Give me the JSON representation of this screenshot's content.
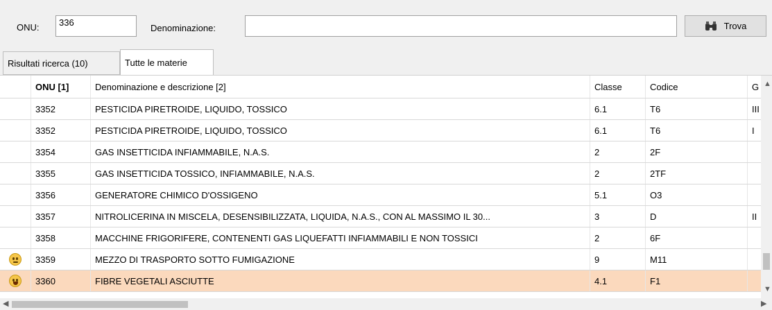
{
  "search": {
    "onu_label": "ONU:",
    "onu_value": "336",
    "denominazione_label": "Denominazione:",
    "denominazione_value": "",
    "trova_label": "Trova",
    "trova_icon": "binoculars-icon"
  },
  "tabs": [
    {
      "label": "Risultati ricerca (10)",
      "active": false
    },
    {
      "label": "Tutte le materie",
      "active": true
    }
  ],
  "table": {
    "headers": [
      "ONU [1]",
      "Denominazione e descrizione [2]",
      "Classe",
      "Codice",
      "G"
    ],
    "rows": [
      {
        "icon": "",
        "onu": "3352",
        "den": "PESTICIDA PIRETROIDE, LIQUIDO, TOSSICO",
        "classe": "6.1",
        "codice": "T6",
        "g": "III"
      },
      {
        "icon": "",
        "onu": "3352",
        "den": "PESTICIDA PIRETROIDE, LIQUIDO, TOSSICO",
        "classe": "6.1",
        "codice": "T6",
        "g": "I"
      },
      {
        "icon": "",
        "onu": "3354",
        "den": "GAS INSETTICIDA INFIAMMABILE, N.A.S.",
        "classe": "2",
        "codice": "2F",
        "g": ""
      },
      {
        "icon": "",
        "onu": "3355",
        "den": "GAS INSETTICIDA TOSSICO, INFIAMMABILE, N.A.S.",
        "classe": "2",
        "codice": "2TF",
        "g": ""
      },
      {
        "icon": "",
        "onu": "3356",
        "den": "GENERATORE CHIMICO D'OSSIGENO",
        "classe": "5.1",
        "codice": "O3",
        "g": ""
      },
      {
        "icon": "",
        "onu": "3357",
        "den": "NITROLICERINA IN MISCELA, DESENSIBILIZZATA, LIQUIDA, N.A.S., CON AL MASSIMO IL 30...",
        "classe": "3",
        "codice": "D",
        "g": "II"
      },
      {
        "icon": "",
        "onu": "3358",
        "den": "MACCHINE FRIGORIFERE, CONTENENTI GAS LIQUEFATTI INFIAMMABILI E NON TOSSICI",
        "classe": "2",
        "codice": "6F",
        "g": ""
      },
      {
        "icon": "neutral-face-icon",
        "onu": "3359",
        "den": "MEZZO DI TRASPORTO SOTTO FUMIGAZIONE",
        "classe": "9",
        "codice": "M11",
        "g": ""
      },
      {
        "icon": "grinning-face-icon",
        "onu": "3360",
        "den": "FIBRE VEGETALI ASCIUTTE",
        "classe": "4.1",
        "codice": "F1",
        "g": "",
        "selected": true
      }
    ]
  },
  "colors": {
    "selected_row": "#fbd9bd",
    "toolbar_bg": "#f0f0f0"
  }
}
